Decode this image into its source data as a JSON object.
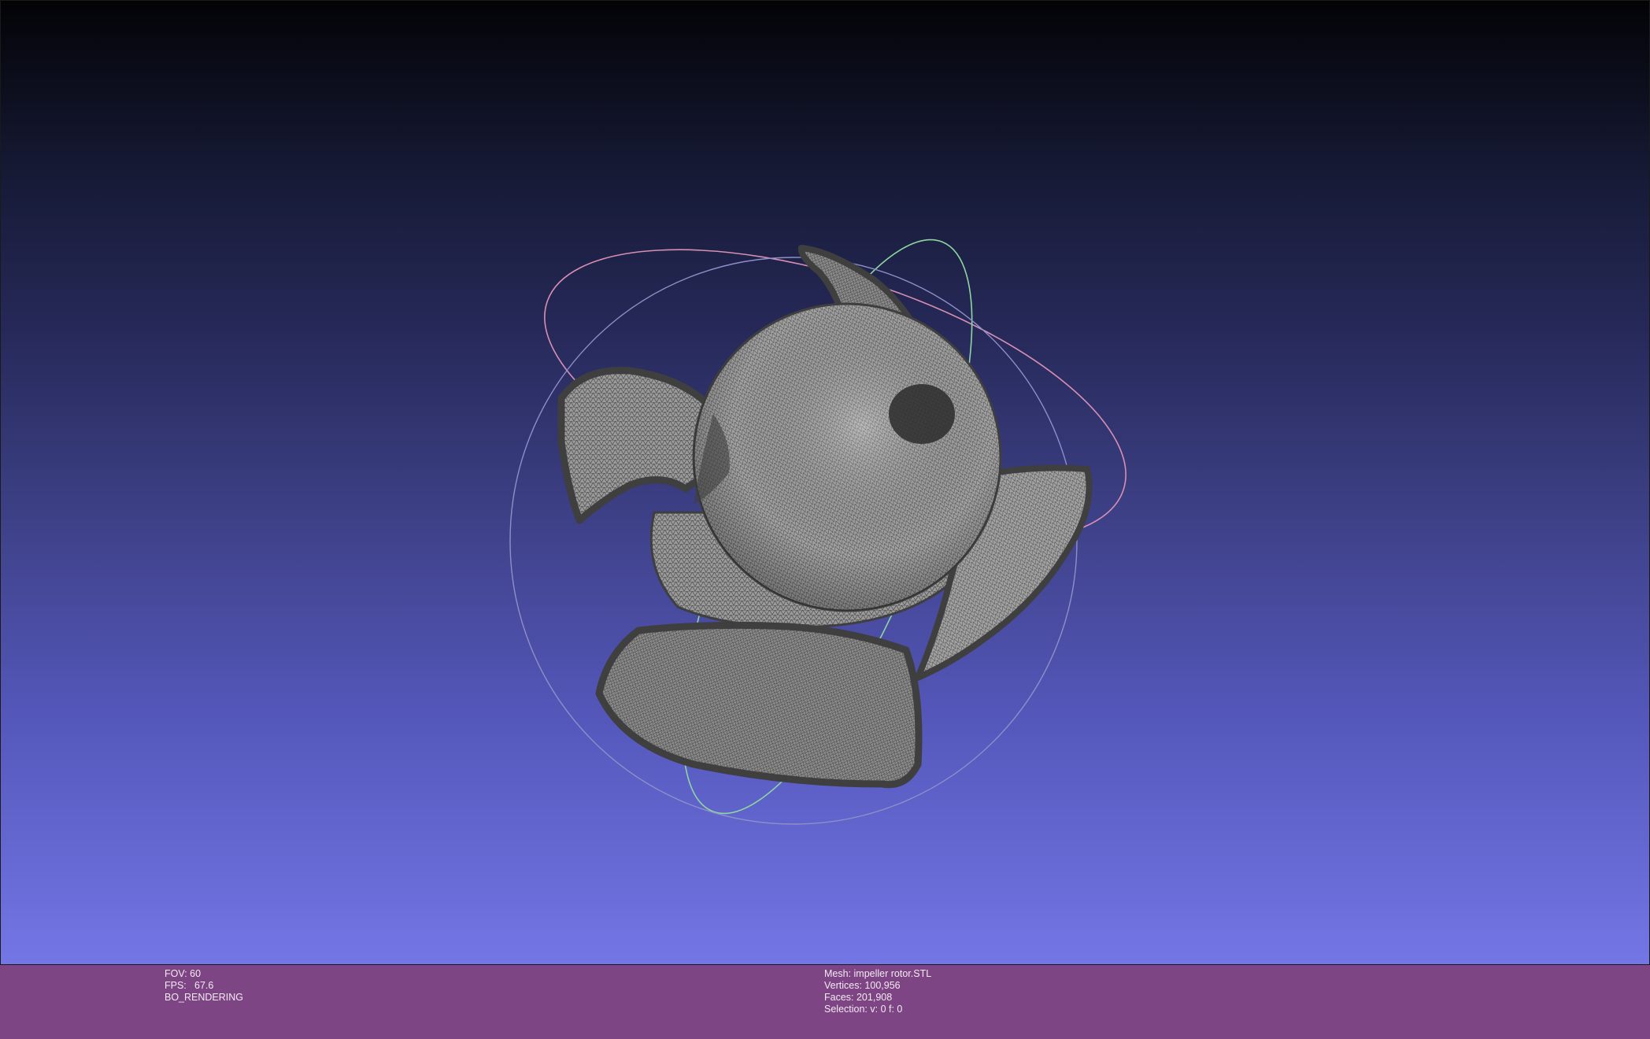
{
  "viewport": {
    "model": "impeller-rotor-mesh",
    "trackball": "trackball-rings"
  },
  "info_left": {
    "fov": "FOV: 60",
    "fps_label": "FPS:",
    "fps_value": "67.6",
    "render_mode": "BO_RENDERING"
  },
  "info_right": {
    "mesh": "Mesh: impeller rotor.STL",
    "vertices": "Vertices: 100,956",
    "faces": "Faces: 201,908",
    "selection": "Selection: v: 0 f: 0"
  },
  "colors": {
    "background_top": "#030306",
    "background_bottom": "#7376e5",
    "info_bar": "#7e4584",
    "mesh_fill": "#8a8a8a",
    "mesh_edge": "#3c3c3c"
  }
}
